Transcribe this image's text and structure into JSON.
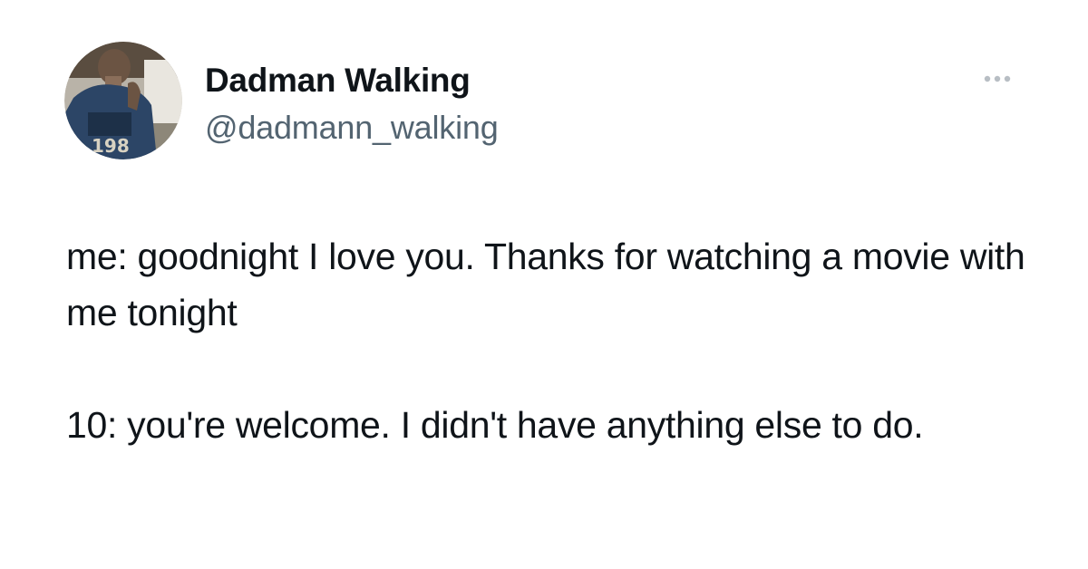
{
  "author": {
    "display_name": "Dadman Walking",
    "handle": "@dadmann_walking",
    "avatar_icon": "user-avatar-photo"
  },
  "menu": {
    "icon": "more-options-icon"
  },
  "tweet": {
    "paragraphs": [
      "me: goodnight I love you. Thanks for watching a movie with me tonight",
      "10: you're welcome. I didn't have anything else to do."
    ]
  },
  "colors": {
    "text": "#0f1419",
    "secondary_text": "#536471",
    "background": "#ffffff"
  }
}
